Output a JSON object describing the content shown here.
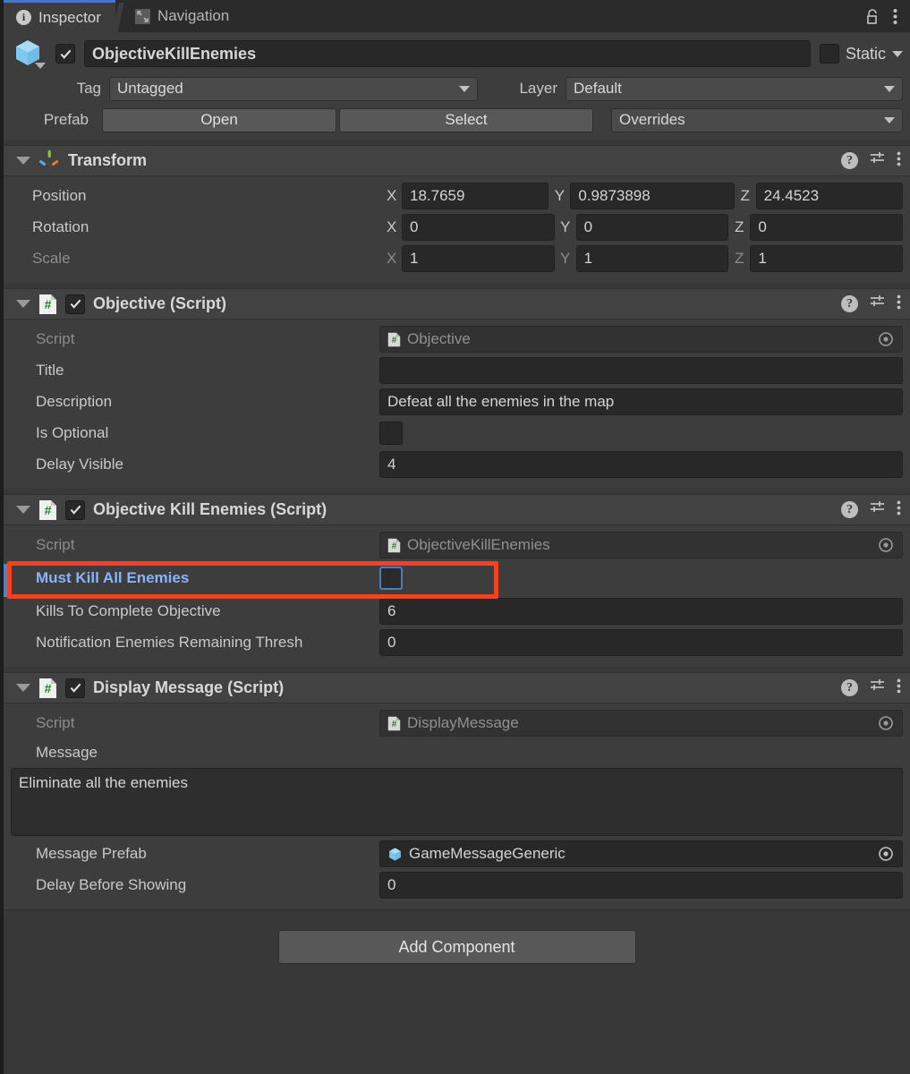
{
  "window": {
    "tabs": [
      {
        "label": "Inspector",
        "icon": "info-icon",
        "active": true
      },
      {
        "label": "Navigation",
        "icon": "navigation-icon",
        "active": false
      }
    ],
    "lock_icon": "lock-open-icon",
    "menu_icon": "kebab-menu-icon"
  },
  "gameobject": {
    "icon": "prefab-cube-icon",
    "enabled_checkbox": true,
    "name": "ObjectiveKillEnemies",
    "static_label": "Static",
    "static_checked": false,
    "tag_label": "Tag",
    "tag_value": "Untagged",
    "layer_label": "Layer",
    "layer_value": "Default",
    "prefab_label": "Prefab",
    "prefab_open": "Open",
    "prefab_select": "Select",
    "prefab_overrides": "Overrides"
  },
  "components": [
    {
      "id": "transform",
      "title": "Transform",
      "icon": "transform-axis-icon",
      "has_checkbox": false,
      "rows": [
        {
          "label": "Position",
          "type": "vector3",
          "x": "18.7659",
          "y": "0.9873898",
          "z": "24.4523"
        },
        {
          "label": "Rotation",
          "type": "vector3",
          "x": "0",
          "y": "0",
          "z": "0"
        },
        {
          "label": "Scale",
          "type": "vector3",
          "dim": true,
          "x": "1",
          "y": "1",
          "z": "1"
        }
      ]
    },
    {
      "id": "objective",
      "title": "Objective (Script)",
      "icon": "csharp-script-icon",
      "has_checkbox": true,
      "checked": true,
      "rows": [
        {
          "label": "Script",
          "type": "object",
          "value": "Objective",
          "dim": true,
          "readonly": true,
          "value_icon": "csharp-script-icon"
        },
        {
          "label": "Title",
          "type": "text",
          "value": ""
        },
        {
          "label": "Description",
          "type": "text",
          "value": "Defeat all the enemies in the map"
        },
        {
          "label": "Is Optional",
          "type": "checkbox",
          "checked": false
        },
        {
          "label": "Delay Visible",
          "type": "text",
          "value": "4"
        }
      ]
    },
    {
      "id": "objective-kill-enemies",
      "title": "Objective Kill Enemies (Script)",
      "icon": "csharp-script-icon",
      "has_checkbox": true,
      "checked": true,
      "rows": [
        {
          "label": "Script",
          "type": "object",
          "value": "ObjectiveKillEnemies",
          "dim": true,
          "readonly": true,
          "value_icon": "csharp-script-icon"
        },
        {
          "label": "Must Kill All Enemies",
          "type": "checkbox",
          "checked": false,
          "highlighted": true,
          "overridden": true
        },
        {
          "label": "Kills To Complete Objective",
          "type": "text",
          "value": "6"
        },
        {
          "label": "Notification Enemies Remaining Thresh",
          "type": "text",
          "value": "0"
        }
      ]
    },
    {
      "id": "display-message",
      "title": "Display Message (Script)",
      "icon": "csharp-script-icon",
      "has_checkbox": true,
      "checked": true,
      "rows": [
        {
          "label": "Script",
          "type": "object",
          "value": "DisplayMessage",
          "dim": true,
          "readonly": true,
          "value_icon": "csharp-script-icon"
        },
        {
          "label": "Message",
          "type": "textarea",
          "value": "Eliminate all the enemies"
        },
        {
          "label": "Message Prefab",
          "type": "object",
          "value": "GameMessageGeneric",
          "value_icon": "prefab-cube-icon"
        },
        {
          "label": "Delay Before Showing",
          "type": "text",
          "value": "0"
        }
      ]
    }
  ],
  "footer": {
    "add_component": "Add Component"
  },
  "colors": {
    "panel_bg": "#383838",
    "component_bg": "#3d3d3d",
    "header_bg": "#424242",
    "field_bg": "#282828",
    "accent_blue": "#3f79c9",
    "highlight_label": "#8ab4f8",
    "annotation_red": "#ef4323",
    "override_bar": "#4f85c4"
  }
}
